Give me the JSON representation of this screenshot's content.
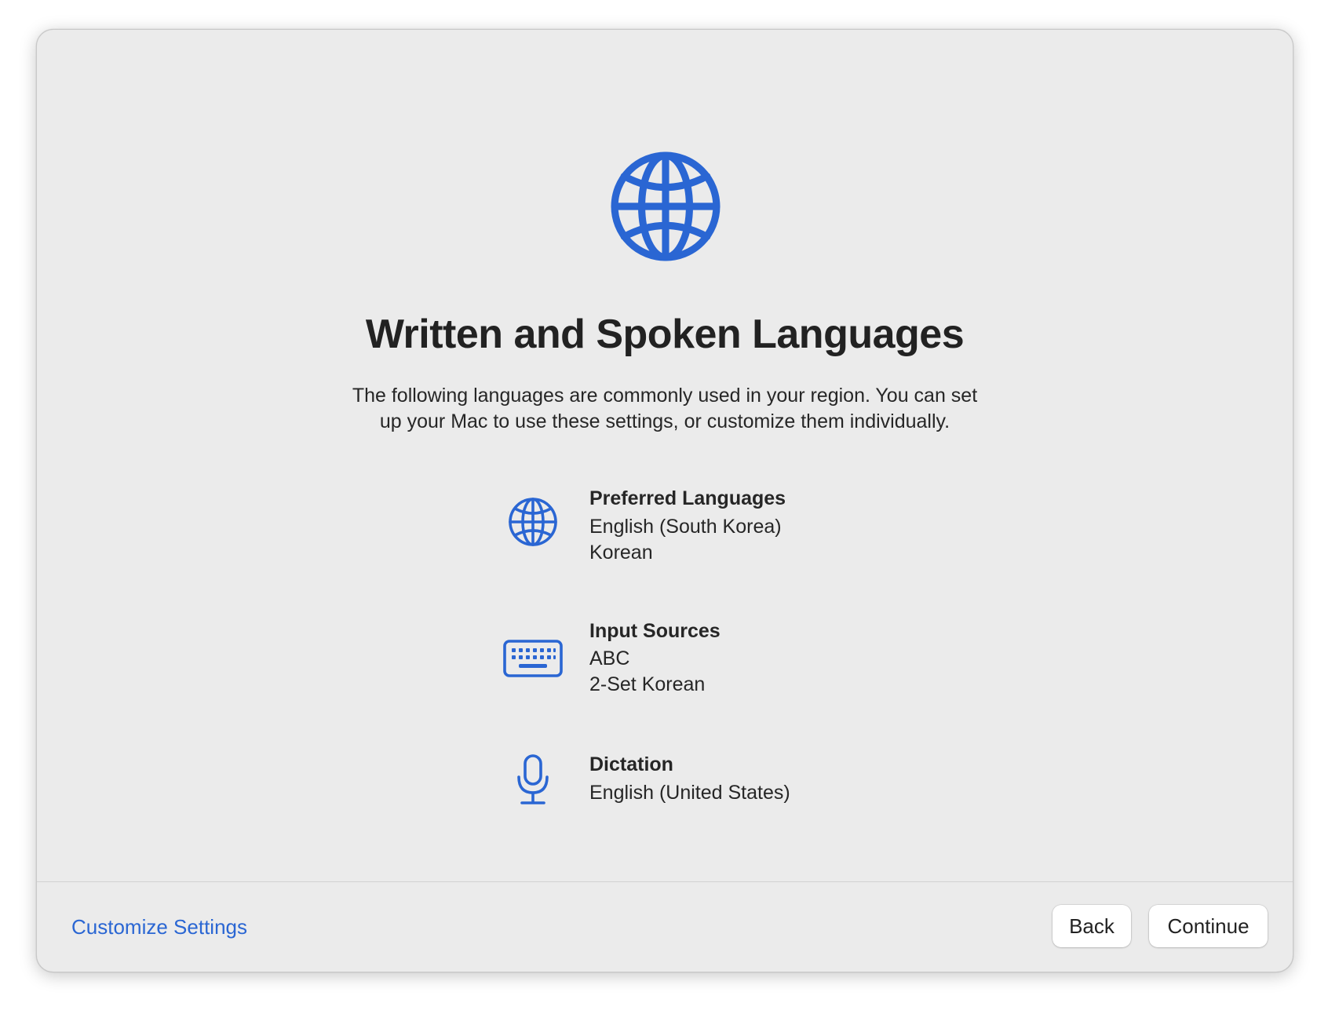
{
  "accent_color": "#2a66d3",
  "hero_icon": "globe-icon",
  "title": "Written and Spoken Languages",
  "subtitle_line1": "The following languages are commonly used in your region. You can set",
  "subtitle_line2": "up your Mac to use these settings, or customize them individually.",
  "sections": [
    {
      "icon": "globe-icon",
      "title": "Preferred Languages",
      "lines": [
        "English (South Korea)",
        "Korean"
      ]
    },
    {
      "icon": "keyboard-icon",
      "title": "Input Sources",
      "lines": [
        "ABC",
        "2-Set Korean"
      ]
    },
    {
      "icon": "microphone-icon",
      "title": "Dictation",
      "lines": [
        "English (United States)"
      ]
    }
  ],
  "footer": {
    "customize_label": "Customize Settings",
    "back_label": "Back",
    "continue_label": "Continue"
  }
}
